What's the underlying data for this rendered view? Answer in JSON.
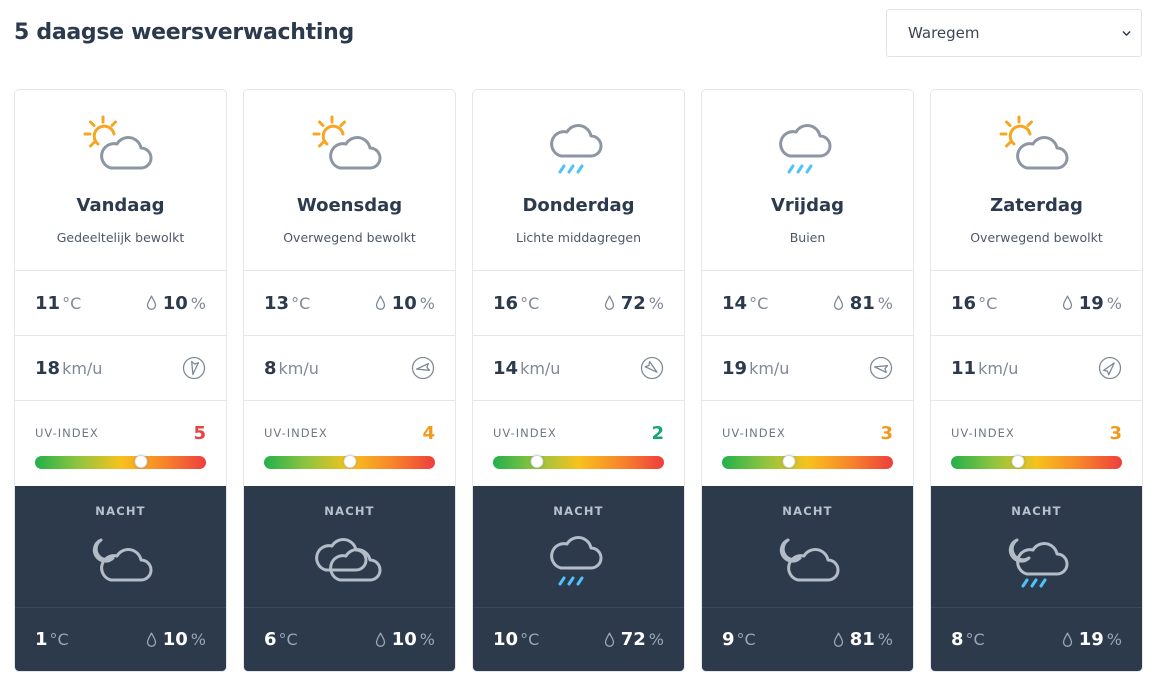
{
  "page": {
    "title": "5 daagse weersverwachting"
  },
  "location_select": {
    "selected": "Waregem"
  },
  "colors": {
    "uv_high": "#e8433f",
    "uv_medium": "#f39a1e",
    "uv_low": "#17a672"
  },
  "days": [
    {
      "name": "Vandaag",
      "description": "Gedeeltelijk bewolkt",
      "icon": "partly-cloudy-day-icon",
      "temp": "11",
      "temp_unit": "°C",
      "rain": "10",
      "rain_unit": "%",
      "wind": "18",
      "wind_unit": "km/u",
      "wind_dir_deg": 190,
      "uv_label": "UV-INDEX",
      "uv": "5",
      "uv_level": 0.62,
      "uv_color": "#e8433f",
      "night_label": "NACHT",
      "night_icon": "partly-cloudy-night-icon",
      "night_temp": "1",
      "night_temp_unit": "°C",
      "night_rain": "10",
      "night_rain_unit": "%"
    },
    {
      "name": "Woensdag",
      "description": "Overwegend bewolkt",
      "icon": "partly-cloudy-day-icon",
      "temp": "13",
      "temp_unit": "°C",
      "rain": "10",
      "rain_unit": "%",
      "wind": "8",
      "wind_unit": "km/u",
      "wind_dir_deg": 260,
      "uv_label": "UV-INDEX",
      "uv": "4",
      "uv_level": 0.5,
      "uv_color": "#f39a1e",
      "night_label": "NACHT",
      "night_icon": "overcast-icon",
      "night_temp": "6",
      "night_temp_unit": "°C",
      "night_rain": "10",
      "night_rain_unit": "%"
    },
    {
      "name": "Donderdag",
      "description": "Lichte middagregen",
      "icon": "rain-icon",
      "temp": "16",
      "temp_unit": "°C",
      "rain": "72",
      "rain_unit": "%",
      "wind": "14",
      "wind_unit": "km/u",
      "wind_dir_deg": 130,
      "uv_label": "UV-INDEX",
      "uv": "2",
      "uv_level": 0.26,
      "uv_color": "#17a672",
      "night_label": "NACHT",
      "night_icon": "rain-icon",
      "night_temp": "10",
      "night_temp_unit": "°C",
      "night_rain": "72",
      "night_rain_unit": "%"
    },
    {
      "name": "Vrijdag",
      "description": "Buien",
      "icon": "rain-icon",
      "temp": "14",
      "temp_unit": "°C",
      "rain": "81",
      "rain_unit": "%",
      "wind": "19",
      "wind_unit": "km/u",
      "wind_dir_deg": 280,
      "uv_label": "UV-INDEX",
      "uv": "3",
      "uv_level": 0.39,
      "uv_color": "#f39a1e",
      "night_label": "NACHT",
      "night_icon": "partly-cloudy-night-icon",
      "night_temp": "9",
      "night_temp_unit": "°C",
      "night_rain": "81",
      "night_rain_unit": "%"
    },
    {
      "name": "Zaterdag",
      "description": "Overwegend bewolkt",
      "icon": "partly-cloudy-day-icon",
      "temp": "16",
      "temp_unit": "°C",
      "rain": "19",
      "rain_unit": "%",
      "wind": "11",
      "wind_unit": "km/u",
      "wind_dir_deg": 40,
      "uv_label": "UV-INDEX",
      "uv": "3",
      "uv_level": 0.39,
      "uv_color": "#f39a1e",
      "night_label": "NACHT",
      "night_icon": "partly-cloudy-night-rain-icon",
      "night_temp": "8",
      "night_temp_unit": "°C",
      "night_rain": "19",
      "night_rain_unit": "%"
    }
  ]
}
